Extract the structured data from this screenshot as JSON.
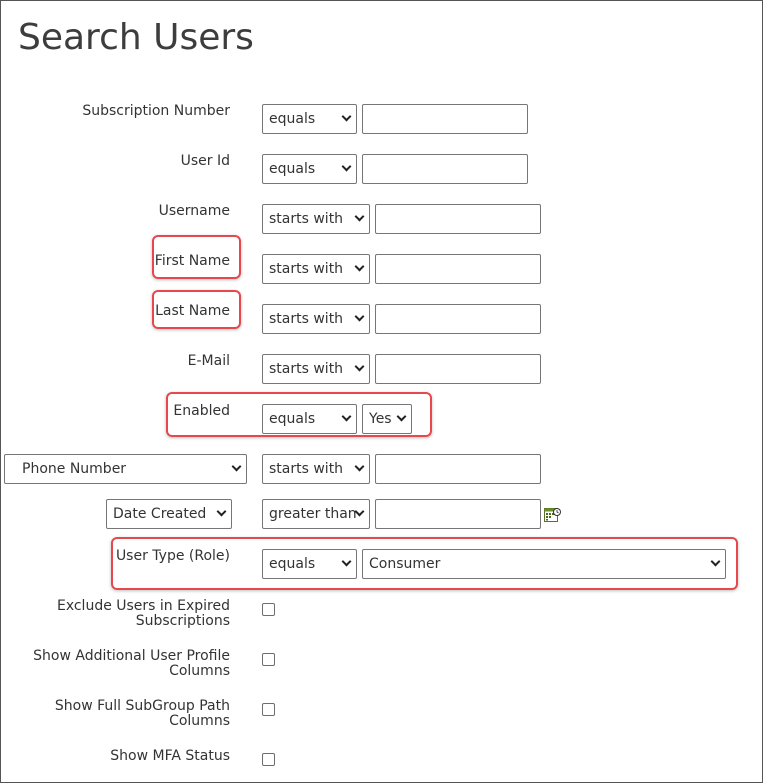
{
  "page": {
    "title": "Search Users"
  },
  "colors": {
    "highlight": "#e5484d",
    "border": "#767676",
    "text": "#333333"
  },
  "fields": {
    "subscription_number": {
      "label": "Subscription Number",
      "operator": "equals",
      "value": ""
    },
    "user_id": {
      "label": "User Id",
      "operator": "equals",
      "value": ""
    },
    "username": {
      "label": "Username",
      "operator": "starts with",
      "value": ""
    },
    "first_name": {
      "label": "First Name",
      "operator": "starts with",
      "value": ""
    },
    "last_name": {
      "label": "Last Name",
      "operator": "starts with",
      "value": ""
    },
    "email": {
      "label": "E-Mail",
      "operator": "starts with",
      "value": ""
    },
    "enabled": {
      "label": "Enabled",
      "operator": "equals",
      "value": "Yes"
    },
    "phone_number": {
      "field": "Phone Number",
      "operator": "starts with",
      "value": ""
    },
    "date_created": {
      "field": "Date Created",
      "operator": "greater than",
      "value": "",
      "calendar_icon": "calendar-icon"
    },
    "user_type": {
      "label": "User Type (Role)",
      "operator": "equals",
      "value": "Consumer"
    }
  },
  "checkboxes": {
    "exclude_expired": {
      "label_line1": "Exclude Users in Expired",
      "label_line2": "Subscriptions",
      "checked": false
    },
    "show_profile_columns": {
      "label_line1": "Show Additional User Profile",
      "label_line2": "Columns",
      "checked": false
    },
    "show_subgroup_path": {
      "label_line1": "Show Full SubGroup Path",
      "label_line2": "Columns",
      "checked": false
    },
    "show_mfa_status": {
      "label": "Show MFA Status",
      "checked": false
    }
  }
}
